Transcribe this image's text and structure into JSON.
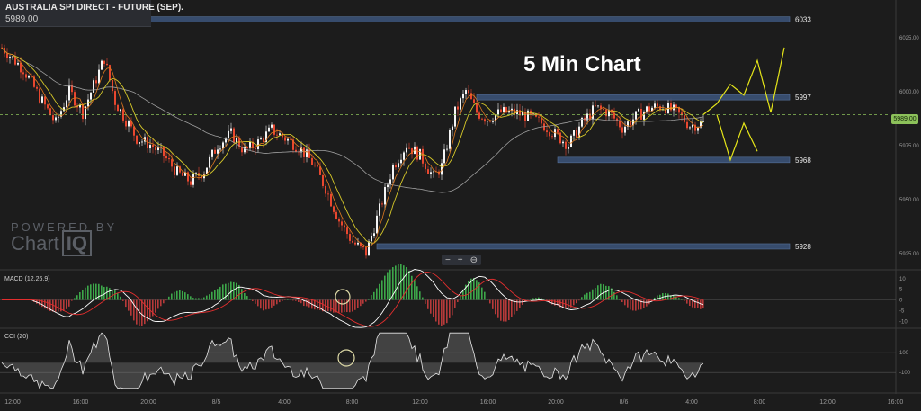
{
  "header": {
    "symbol": "AUSTRALIA SPI DIRECT - FUTURE (SEP).",
    "price": "5989.00"
  },
  "watermark": {
    "powered": "POWERED BY",
    "brand_a": "Chart",
    "brand_b": "IQ"
  },
  "zoom": {
    "minus": "−",
    "plus": "+",
    "reset": "⊖"
  },
  "chart_data": {
    "type": "candlestick",
    "title": "5 Min Chart",
    "price_axis": {
      "ylim": [
        5918,
        6037
      ],
      "ticks": [
        "6025.00",
        "6000.00",
        "5975.00",
        "5950.00",
        "5925.00"
      ],
      "current": "5989.00"
    },
    "time_axis": [
      "12:00",
      "16:00",
      "20:00",
      "8/5",
      "4:00",
      "8:00",
      "12:00",
      "16:00",
      "20:00",
      "8/6",
      "4:00",
      "8:00",
      "12:00",
      "16:00"
    ],
    "levels": [
      {
        "label": "6033",
        "value": 6033
      },
      {
        "label": "5997",
        "value": 5997
      },
      {
        "label": "5968",
        "value": 5968
      },
      {
        "label": "5928",
        "value": 5928
      }
    ],
    "price_path": [
      [
        0,
        6020
      ],
      [
        8,
        6010
      ],
      [
        15,
        5995
      ],
      [
        20,
        5985
      ],
      [
        25,
        6000
      ],
      [
        30,
        5990
      ],
      [
        38,
        6015
      ],
      [
        42,
        5995
      ],
      [
        50,
        5978
      ],
      [
        55,
        5975
      ],
      [
        60,
        5970
      ],
      [
        65,
        5962
      ],
      [
        70,
        5958
      ],
      [
        75,
        5963
      ],
      [
        80,
        5975
      ],
      [
        85,
        5980
      ],
      [
        90,
        5972
      ],
      [
        95,
        5976
      ],
      [
        100,
        5982
      ],
      [
        105,
        5978
      ],
      [
        110,
        5974
      ],
      [
        115,
        5967
      ],
      [
        120,
        5955
      ],
      [
        125,
        5940
      ],
      [
        130,
        5930
      ],
      [
        135,
        5925
      ],
      [
        140,
        5945
      ],
      [
        145,
        5965
      ],
      [
        150,
        5975
      ],
      [
        155,
        5970
      ],
      [
        160,
        5960
      ],
      [
        163,
        5965
      ],
      [
        168,
        5990
      ],
      [
        172,
        6000
      ],
      [
        176,
        5990
      ],
      [
        180,
        5987
      ],
      [
        185,
        5990
      ],
      [
        190,
        5990
      ],
      [
        195,
        5988
      ],
      [
        200,
        5985
      ],
      [
        205,
        5980
      ],
      [
        210,
        5975
      ],
      [
        215,
        5985
      ],
      [
        220,
        5992
      ],
      [
        225,
        5990
      ],
      [
        230,
        5983
      ],
      [
        235,
        5988
      ],
      [
        240,
        5992
      ],
      [
        245,
        5993
      ],
      [
        250,
        5990
      ],
      [
        255,
        5984
      ],
      [
        260,
        5985
      ]
    ],
    "projection": [
      [
        260,
        5989
      ],
      [
        265,
        5994
      ],
      [
        270,
        6003
      ],
      [
        275,
        5998
      ],
      [
        280,
        6014
      ],
      [
        285,
        5990
      ],
      [
        290,
        6020
      ]
    ],
    "projection_alt": [
      [
        265,
        5989
      ],
      [
        270,
        5968
      ],
      [
        275,
        5985
      ],
      [
        280,
        5972
      ]
    ],
    "macd": {
      "label": "MACD (12,26,9)",
      "ylim": [
        -12,
        12
      ],
      "ticks": [
        "10",
        "5",
        "0",
        "-5",
        "-10"
      ]
    },
    "cci": {
      "label": "CCI (20)",
      "ylim": [
        -280,
        320
      ],
      "ticks": [
        "100",
        "-100"
      ]
    },
    "colors": {
      "up": "#f4f4f4",
      "down": "#e8472f",
      "ma_fast": "#e07a1f",
      "ma_mid": "#d6c829",
      "ma_slow": "#9e9e9e",
      "level_band": "#3a5276",
      "macd": "#ffffff",
      "signal": "#e32e2e",
      "hist_up": "#3da84a",
      "hist_down": "#b73a3a",
      "projection": "#e6e619",
      "current": "#8cc15a"
    }
  }
}
